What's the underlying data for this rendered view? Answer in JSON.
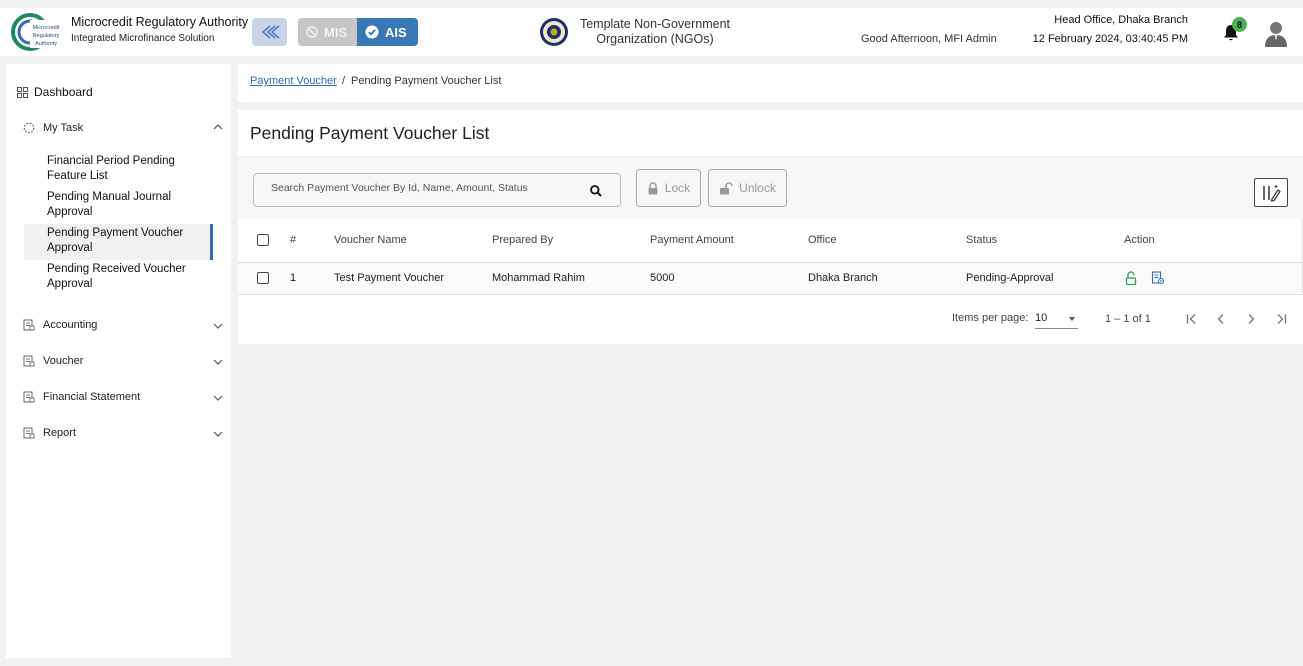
{
  "header": {
    "logo_text": [
      "Microcredit",
      "Regulatory",
      "Authority"
    ],
    "brand_title": "Microcredit Regulatory Authority",
    "brand_subtitle": "Integrated Microfinance Solution",
    "modules": [
      {
        "label": "MIS",
        "state": "disabled"
      },
      {
        "label": "AIS",
        "state": "active"
      }
    ],
    "org_name": "Template Non-Government Organization (NGOs)",
    "greeting": "Good Afternoon, MFI Admin",
    "office": "Head Office, Dhaka Branch",
    "datetime": "12 February 2024, 03:40:45 PM",
    "notification_count": "8",
    "colors": {
      "accent": "#3978b7",
      "badge": "#4caf50",
      "collapse_bg": "#c9d4e8"
    }
  },
  "sidebar": {
    "dashboard": "Dashboard",
    "my_task": {
      "label": "My Task",
      "items": [
        "Financial Period Pending Feature List",
        "Pending Manual Journal Approval",
        "Pending Payment Voucher Approval",
        "Pending Received Voucher Approval"
      ],
      "active_index": 2
    },
    "groups": [
      "Accounting",
      "Voucher",
      "Financial Statement",
      "Report"
    ]
  },
  "breadcrumb": {
    "parent": "Payment Voucher",
    "separator": "/",
    "current": "Pending Payment Voucher List"
  },
  "page": {
    "title": "Pending Payment Voucher List",
    "search_placeholder": "Search Payment Voucher By Id, Name, Amount, Status",
    "lock_label": "Lock",
    "unlock_label": "Unlock"
  },
  "table": {
    "columns": [
      "#",
      "Voucher Name",
      "Prepared By",
      "Payment Amount",
      "Office",
      "Status",
      "Action"
    ],
    "rows": [
      {
        "index": "1",
        "voucher_name": "Test Payment Voucher",
        "prepared_by": "Mohammad Rahim",
        "amount": "5000",
        "office": "Dhaka Branch",
        "status": "Pending-Approval"
      }
    ]
  },
  "paginator": {
    "items_per_page_label": "Items per page:",
    "items_per_page": "10",
    "range": "1 – 1 of 1"
  }
}
